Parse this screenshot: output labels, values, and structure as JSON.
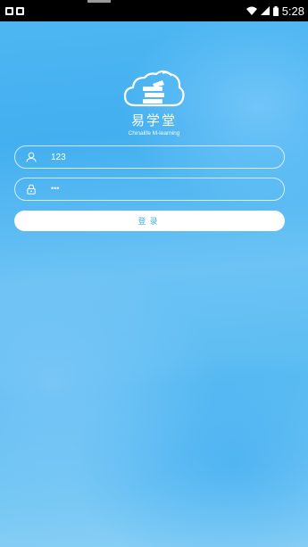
{
  "status_bar": {
    "time": "5:28",
    "icons": [
      "notification-indicator-icon",
      "android-debug-icon",
      "wifi-icon",
      "signal-icon",
      "battery-icon"
    ]
  },
  "logo": {
    "title": "易学堂",
    "subtitle": "Chinalife M-learning",
    "icon": "cloud-book-icon"
  },
  "form": {
    "username": {
      "value": "123",
      "icon": "user-icon"
    },
    "password": {
      "value": "•••",
      "icon": "lock-icon"
    },
    "login_label": "登录"
  },
  "colors": {
    "background": "#4fb8f2",
    "button_bg": "#ffffff",
    "button_text": "#4ab2ee"
  }
}
